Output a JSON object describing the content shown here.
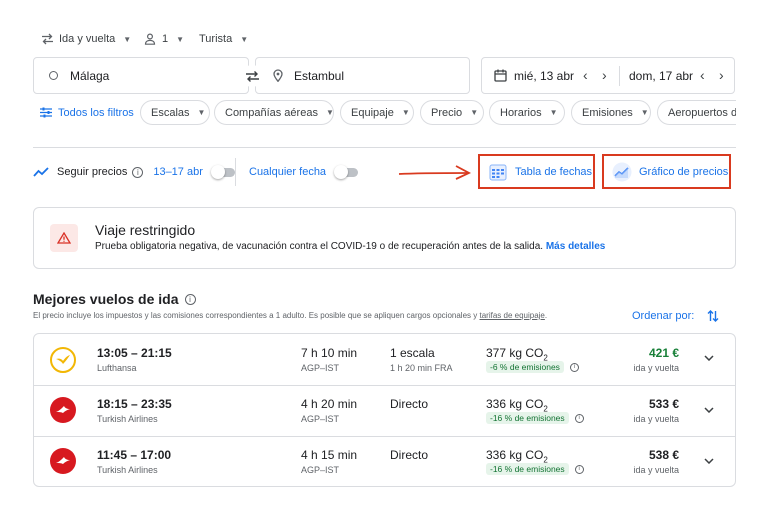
{
  "search": {
    "trip_type": "Ida y vuelta",
    "passengers": "1",
    "cabin": "Turista",
    "origin": "Málaga",
    "destination": "Estambul",
    "depart_date": "mié, 13 abr",
    "return_date": "dom, 17 abr"
  },
  "filters": {
    "all_filters": "Todos los filtros",
    "chips": [
      "Escalas",
      "Compañías aéreas",
      "Equipaje",
      "Precio",
      "Horarios",
      "Emisiones",
      "Aeropuertos de"
    ]
  },
  "tracking": {
    "track_label": "Seguir precios",
    "dates": "13–17 abr",
    "any_date": "Cualquier fecha",
    "date_grid": "Tabla de fechas",
    "price_graph": "Gráfico de precios"
  },
  "alert": {
    "title": "Viaje restringido",
    "text": "Prueba obligatoria negativa, de vacunación contra el COVID-19 o de recuperación antes de la salida.",
    "link": "Más detalles"
  },
  "results": {
    "heading": "Mejores vuelos de ida",
    "subtitle": "El precio incluye los impuestos y las comisiones correspondientes a 1 adulto. Es posible que se apliquen cargos opcionales y",
    "subtitle_link": "tarifas de equipaje",
    "subtitle_end": ".",
    "sort_label": "Ordenar por:"
  },
  "flights": [
    {
      "times": "13:05 – 21:15",
      "airline": "Lufthansa",
      "duration": "7 h 10 min",
      "route": "AGP–IST",
      "stops": "1 escala",
      "stop_detail": "1 h 20 min FRA",
      "emissions": "377 kg CO",
      "emissions_sub": "2",
      "emissions_delta": "-6 % de emisiones",
      "price": "421 €",
      "price_color": "#188038",
      "price_label": "ida y vuelta"
    },
    {
      "times": "18:15 – 23:35",
      "airline": "Turkish Airlines",
      "duration": "4 h 20 min",
      "route": "AGP–IST",
      "stops": "Directo",
      "stop_detail": "",
      "emissions": "336 kg CO",
      "emissions_sub": "2",
      "emissions_delta": "-16 % de emisiones",
      "price": "533 €",
      "price_color": "#202124",
      "price_label": "ida y vuelta"
    },
    {
      "times": "11:45 – 17:00",
      "airline": "Turkish Airlines",
      "duration": "4 h 15 min",
      "route": "AGP–IST",
      "stops": "Directo",
      "stop_detail": "",
      "emissions": "336 kg CO",
      "emissions_sub": "2",
      "emissions_delta": "-16 % de emisiones",
      "price": "538 €",
      "price_color": "#202124",
      "price_label": "ida y vuelta"
    }
  ],
  "colors": {
    "accent": "#1a73e8",
    "highlight_border": "#d93a1f",
    "cheap_price": "#188038"
  }
}
